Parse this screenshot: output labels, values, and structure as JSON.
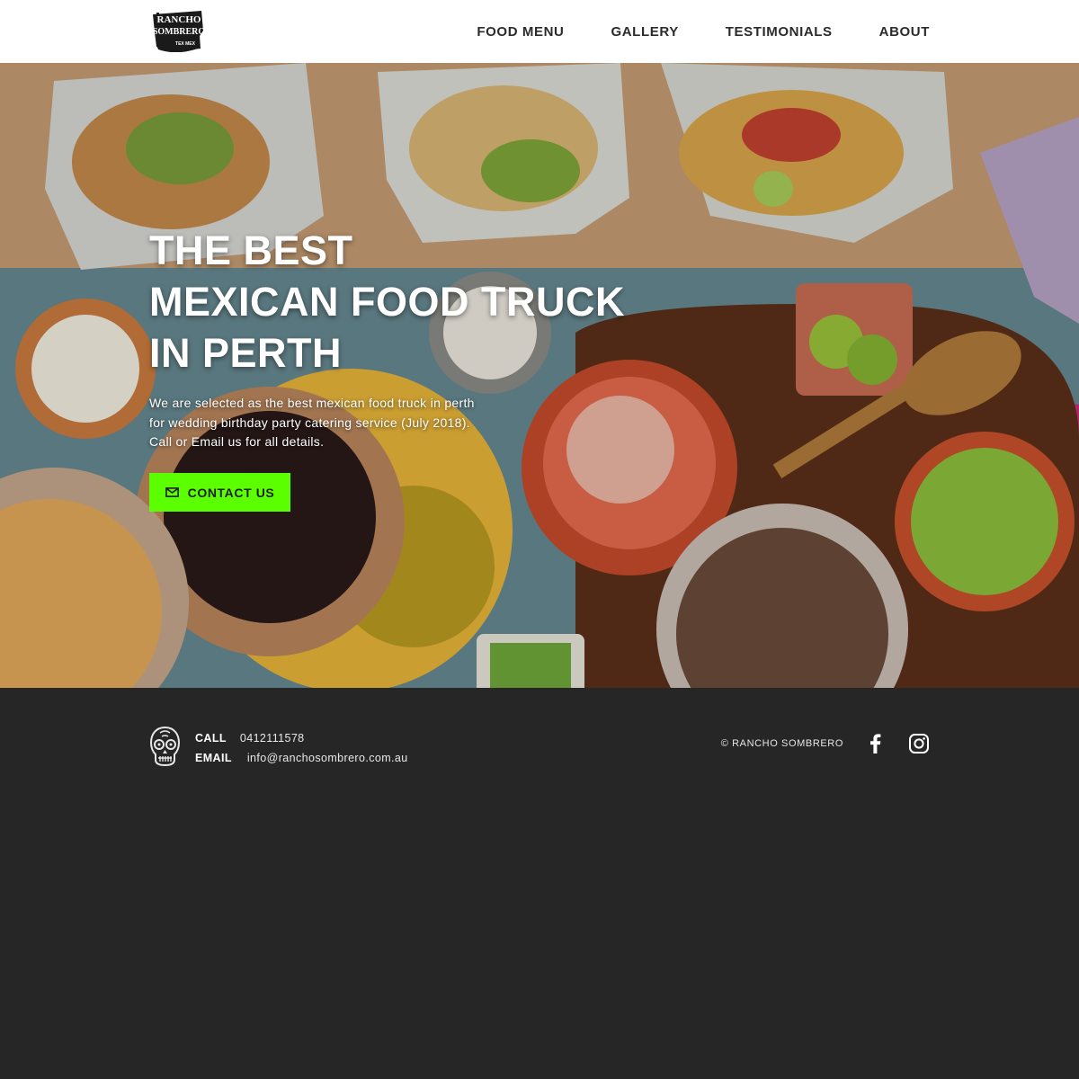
{
  "brand": {
    "logo_line1": "RANCHO",
    "logo_line2": "SOMBRERO",
    "logo_line3": "TEX MEX"
  },
  "nav": {
    "items": [
      {
        "label": "FOOD MENU"
      },
      {
        "label": "GALLERY"
      },
      {
        "label": "TESTIMONIALS"
      },
      {
        "label": "ABOUT"
      }
    ]
  },
  "hero": {
    "title_lines": [
      "THE BEST",
      "MEXICAN FOOD TRUCK",
      "IN PERTH"
    ],
    "description_lines": [
      "We are selected as the best mexican food truck in perth",
      "for wedding birthday party catering service (July 2018).",
      "Call or Email us for all details."
    ],
    "cta_label": "CONTACT US",
    "cta_icon": "mail-icon",
    "accent_color": "#5cff00"
  },
  "footer": {
    "call_label": "CALL",
    "call_value": "0412111578",
    "email_label": "EMAIL",
    "email_value": "info@ranchosombrero.com.au",
    "copyright": "© RANCHO SOMBRERO",
    "social": [
      {
        "icon": "facebook-icon"
      },
      {
        "icon": "instagram-icon"
      }
    ],
    "background_color": "#262626"
  }
}
